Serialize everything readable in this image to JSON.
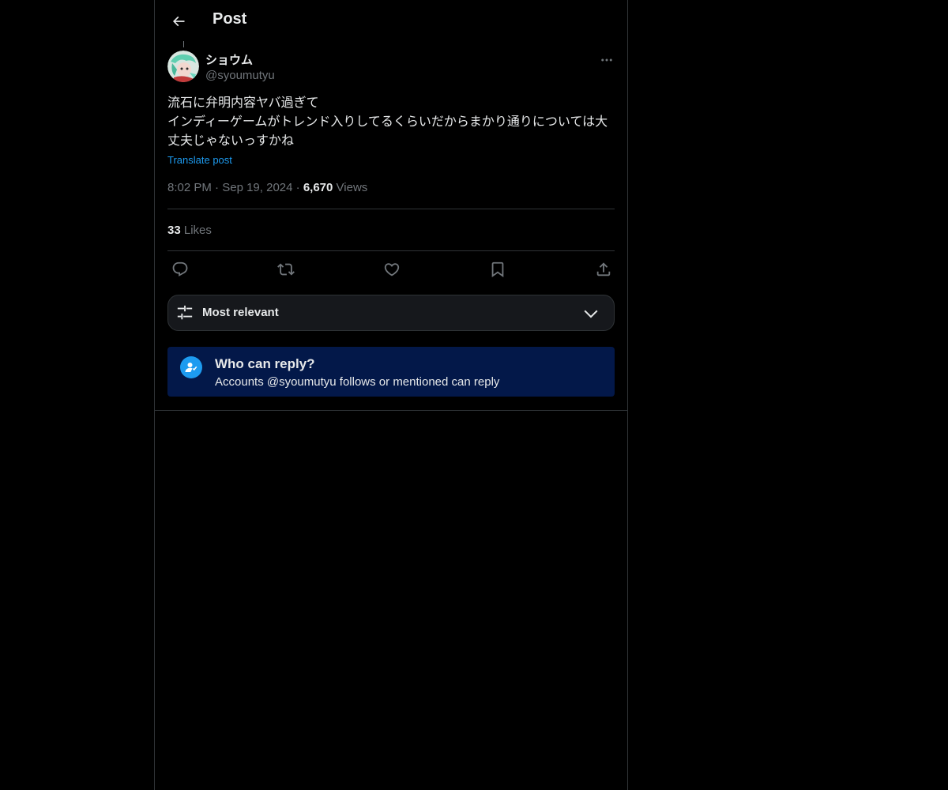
{
  "header": {
    "title": "Post",
    "back_icon": "arrow-left-icon"
  },
  "post": {
    "author_name": "ショウム",
    "author_handle": "@syoumutyu",
    "text": "流石に弁明内容ヤバ過ぎて\nインディーゲームがトレンド入りしてるくらいだからまかり通りについては大丈夫じゃないっすかね",
    "translate_label": "Translate post",
    "time": "8:02 PM",
    "date": "Sep 19, 2024",
    "separator": "·",
    "views_count": "6,670",
    "views_label": "Views",
    "likes_count": "33",
    "likes_label": "Likes"
  },
  "actions": [
    "reply-icon",
    "repost-icon",
    "like-icon",
    "bookmark-icon",
    "share-icon"
  ],
  "sort": {
    "label": "Most relevant",
    "icon": "sliders-icon",
    "chevron": "chevron-down-icon"
  },
  "reply_restriction": {
    "title": "Who can reply?",
    "subtitle": "Accounts @syoumutyu follows or mentioned can reply",
    "icon": "user-check-icon"
  },
  "colors": {
    "background": "#000000",
    "text": "#e7e9ea",
    "muted": "#71767b",
    "accent": "#1d9bf0",
    "reply_box_bg": "#031849"
  }
}
